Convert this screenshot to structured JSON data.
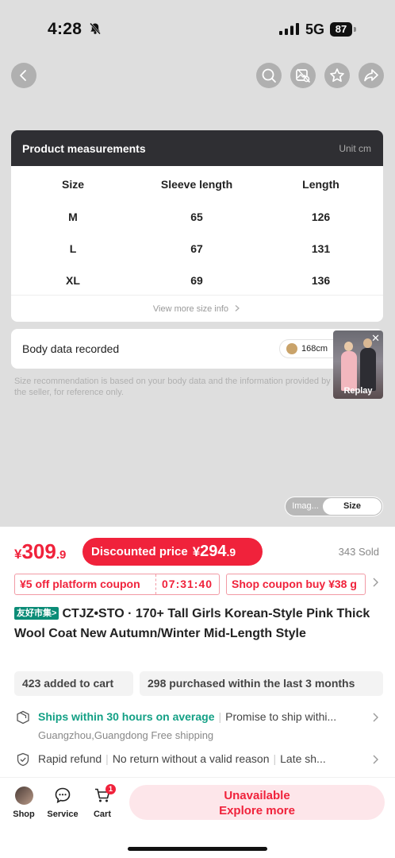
{
  "status_bar": {
    "time": "4:28",
    "network": "5G",
    "battery": "87"
  },
  "measurements": {
    "title": "Product measurements",
    "unit": "Unit cm",
    "columns": [
      "Size",
      "Sleeve length",
      "Length"
    ],
    "rows": [
      [
        "M",
        "65",
        "126"
      ],
      [
        "L",
        "67",
        "131"
      ],
      [
        "XL",
        "69",
        "136"
      ]
    ],
    "view_more": "View more size info"
  },
  "body_data": {
    "title": "Body data recorded",
    "height": "168cm"
  },
  "video": {
    "replay_label": "Replay"
  },
  "size_note": "Size recommendation is based on your body data and the information provided by the seller, for reference only.",
  "toggle": {
    "image_label": "Imag...",
    "size_label": "Size"
  },
  "price": {
    "currency": "¥",
    "main_int": "309",
    "main_dec": ".9",
    "discount_label": "Discounted price",
    "discount_int": "294",
    "discount_dec": ".9",
    "sold": "343 Sold"
  },
  "coupons": {
    "platform": "¥5 off platform coupon",
    "timer": "07:31:40",
    "shop": "Shop coupon buy ¥38 g"
  },
  "product": {
    "shop_tag": "友好市集>",
    "title": "CTJZ•STO · 170+ Tall Girls Korean-Style Pink Thick Wool Coat New Autumn/Winter Mid-Length Style"
  },
  "stats": {
    "added_to_cart": "423 added to cart",
    "purchased": "298 purchased within the last 3 months"
  },
  "shipping": {
    "highlight": "Ships within 30 hours on average",
    "promise": "Promise to ship withi...",
    "sub": "Guangzhou,Guangdong Free shipping"
  },
  "refund": {
    "rapid": "Rapid refund",
    "no_return": "No return without a valid reason",
    "late": "Late sh..."
  },
  "bottom_nav": {
    "shop": "Shop",
    "service": "Service",
    "cart": "Cart",
    "cart_count": "1",
    "unavailable": "Unavailable",
    "explore": "Explore more"
  },
  "colors": {
    "accent_red": "#f0223b",
    "green": "#13a085",
    "dark_header": "#2f2f33"
  }
}
